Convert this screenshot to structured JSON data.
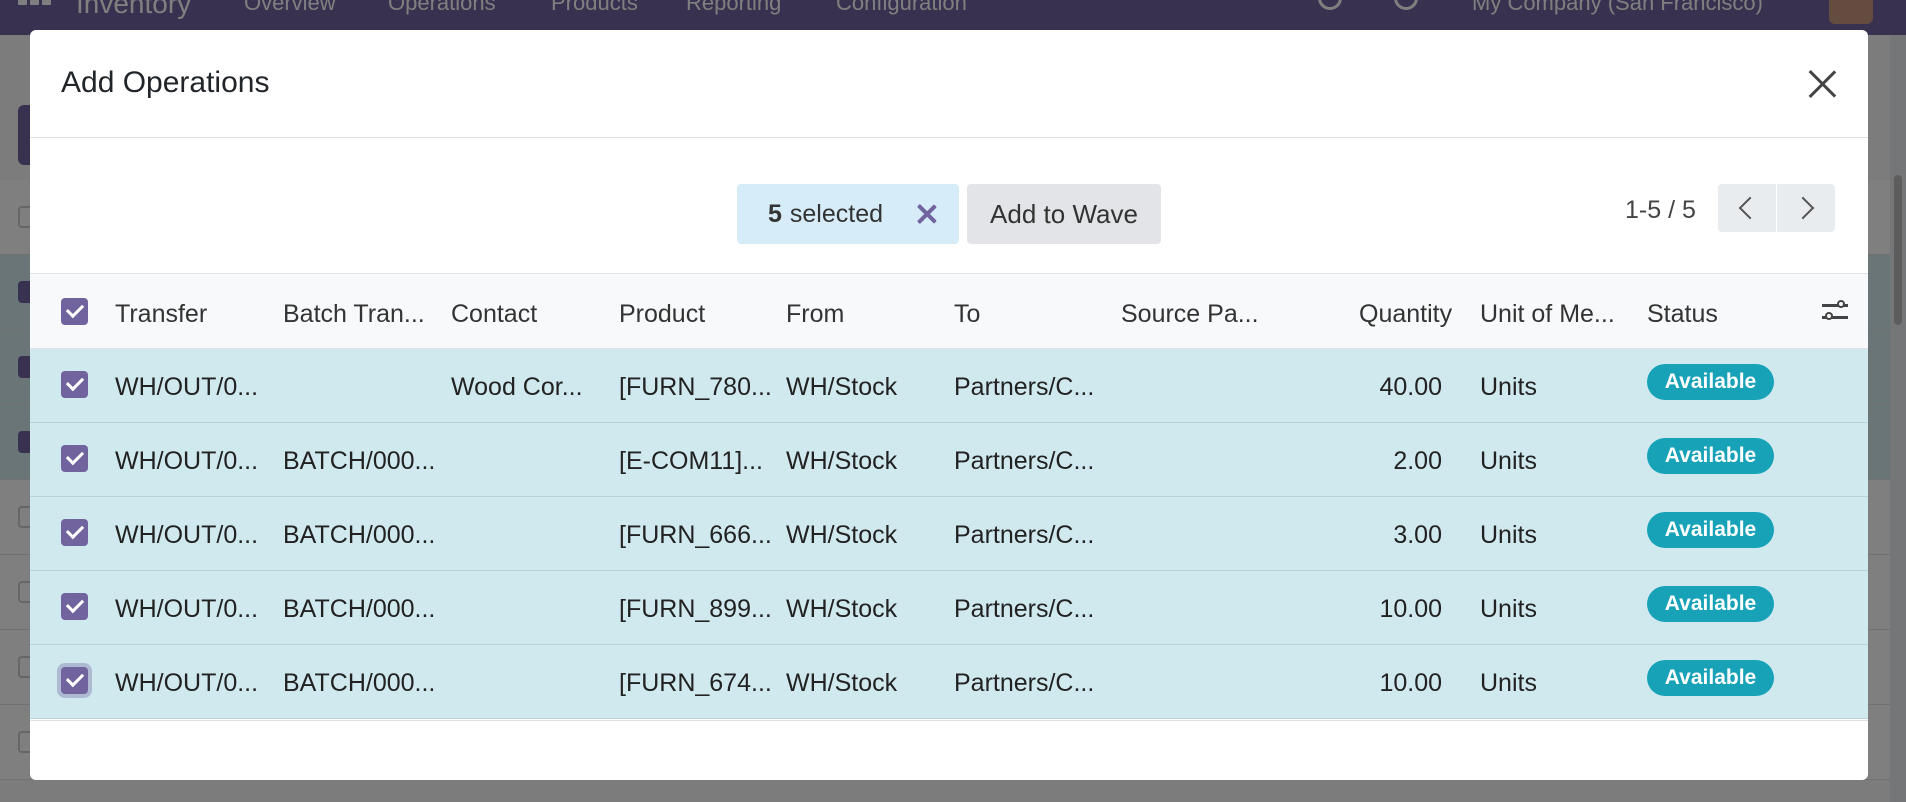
{
  "app": {
    "brand": "Inventory",
    "menu": [
      "Overview",
      "Operations",
      "Products",
      "Reporting",
      "Configuration"
    ],
    "company": "My Company (San Francisco)"
  },
  "modal": {
    "title": "Add Operations",
    "selection": {
      "count": "5",
      "label": "selected"
    },
    "add_button": "Add to Wave",
    "pager": "1-5 / 5"
  },
  "table": {
    "columns": {
      "transfer": "Transfer",
      "batch": "Batch Tran...",
      "contact": "Contact",
      "product": "Product",
      "from": "From",
      "to": "To",
      "source": "Source Pa...",
      "quantity": "Quantity",
      "uom": "Unit of Me...",
      "status": "Status"
    },
    "rows": [
      {
        "transfer": "WH/OUT/0...",
        "batch": "",
        "contact": "Wood Cor...",
        "product": "[FURN_780...",
        "from": "WH/Stock",
        "to": "Partners/C...",
        "source": "",
        "quantity": "40.00",
        "uom": "Units",
        "status": "Available"
      },
      {
        "transfer": "WH/OUT/0...",
        "batch": "BATCH/000...",
        "contact": "",
        "product": "[E-COM11]...",
        "from": "WH/Stock",
        "to": "Partners/C...",
        "source": "",
        "quantity": "2.00",
        "uom": "Units",
        "status": "Available"
      },
      {
        "transfer": "WH/OUT/0...",
        "batch": "BATCH/000...",
        "contact": "",
        "product": "[FURN_666...",
        "from": "WH/Stock",
        "to": "Partners/C...",
        "source": "",
        "quantity": "3.00",
        "uom": "Units",
        "status": "Available"
      },
      {
        "transfer": "WH/OUT/0...",
        "batch": "BATCH/000...",
        "contact": "",
        "product": "[FURN_899...",
        "from": "WH/Stock",
        "to": "Partners/C...",
        "source": "",
        "quantity": "10.00",
        "uom": "Units",
        "status": "Available"
      },
      {
        "transfer": "WH/OUT/0...",
        "batch": "BATCH/000...",
        "contact": "",
        "product": "[FURN_674...",
        "from": "WH/Stock",
        "to": "Partners/C...",
        "source": "",
        "quantity": "10.00",
        "uom": "Units",
        "status": "Available"
      }
    ]
  },
  "colors": {
    "brand": "#71639e",
    "row_selected": "#d0e9ef",
    "status_available": "#17a2b8",
    "selection_pill": "#d6ecf8"
  }
}
